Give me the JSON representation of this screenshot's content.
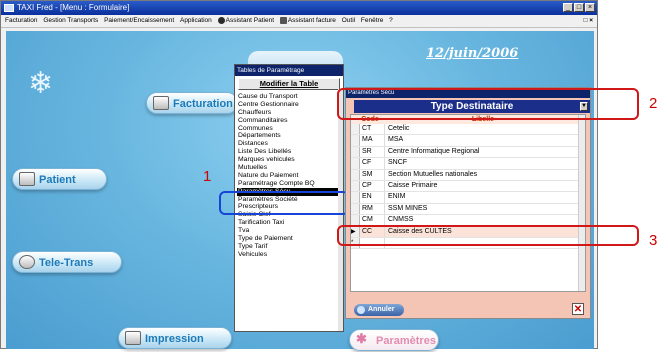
{
  "window": {
    "title": "TAXI Fred - [Menu : Formulaire]",
    "controls": [
      "_",
      "□",
      "×"
    ],
    "inner_controls": [
      "□",
      "×"
    ]
  },
  "menu": [
    "Facturation",
    "Gestion Transports",
    "Paiement/Encaissement",
    "Application",
    "Assistant Patient",
    "Assistant facture",
    "Outil",
    "Fenêtre",
    "?"
  ],
  "date": "12/juin/2006",
  "main_buttons": {
    "facturation": "Facturation",
    "patient": "Patient",
    "teletrans": "Tele-Trans",
    "impression": "Impression",
    "parametres": "Paramètres"
  },
  "tables_popup": {
    "title": "Tables de Paramétrage",
    "modify_button": "Modifier la Table",
    "items": [
      "Cause du Transport",
      "Centre Gestionnaire",
      "Chauffeurs",
      "Commanditaires",
      "Communes",
      "Départements",
      "Distances",
      "Liste Des Libellés",
      "Marques vehicules",
      "Mutuelles",
      "Nature du Paiement",
      "Paramétrage  Compte BQ",
      "Paramètres Sécu",
      "Paramètres Société",
      "Prescripteurs",
      "Saisie Clef",
      "Tarification Taxi",
      "Tva",
      "Type de Paiement",
      "Type Tarif",
      "Vehicules"
    ],
    "selected_index": 12
  },
  "secu_window": {
    "header": "Paramètres Sécu",
    "dropdown_title": "Type Destinataire",
    "columns": {
      "code": "Code",
      "libelle": "Libelle"
    },
    "rows": [
      {
        "code": "CT",
        "libelle": "Cetelic"
      },
      {
        "code": "MA",
        "libelle": "MSA"
      },
      {
        "code": "SR",
        "libelle": "Centre Informatique Regional"
      },
      {
        "code": "CF",
        "libelle": "SNCF"
      },
      {
        "code": "SM",
        "libelle": "Section Mutuelles nationales"
      },
      {
        "code": "CP",
        "libelle": "Caisse Primaire"
      },
      {
        "code": "EN",
        "libelle": "ENIM"
      },
      {
        "code": "RM",
        "libelle": "SSM MINES"
      },
      {
        "code": "CM",
        "libelle": "CNMSS"
      },
      {
        "code": "CC",
        "libelle": "Caisse des CULTES"
      },
      {
        "code": "",
        "libelle": ""
      }
    ],
    "current_row_index": 9,
    "cancel_button": "Annuler"
  },
  "callouts": {
    "one": "1",
    "two": "2",
    "three": "3"
  },
  "colors": {
    "canvas": "#69b7e0",
    "button_text": "#1d7ab8",
    "secu_bg": "#f4c5b4",
    "callout_red": "#d01818",
    "callout_blue": "#1744d8"
  }
}
